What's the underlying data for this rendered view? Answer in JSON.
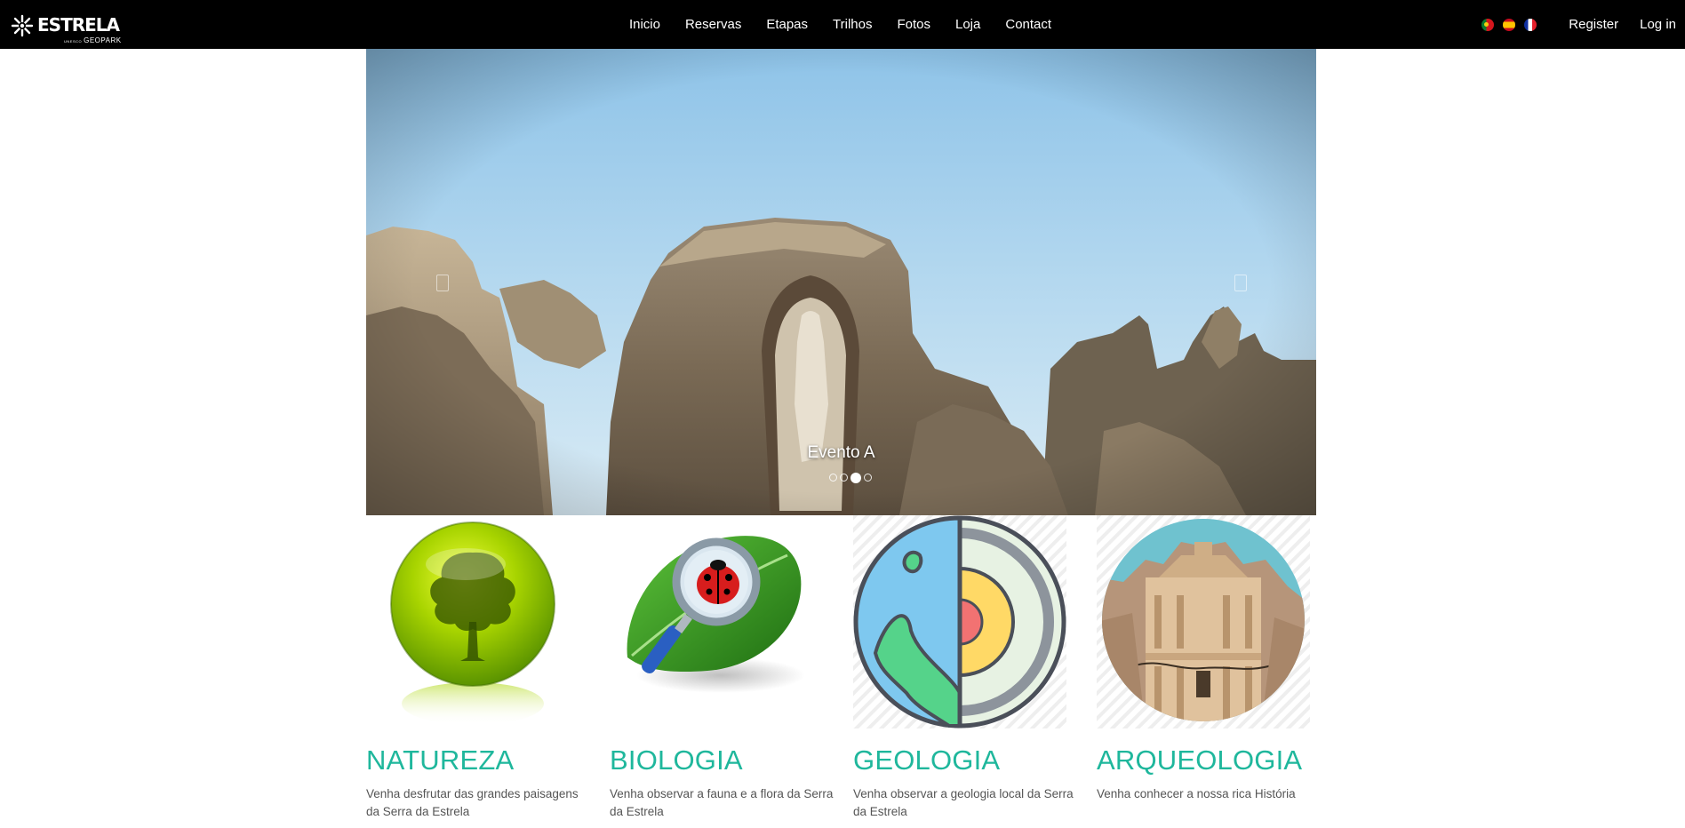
{
  "brand": {
    "name": "ESTRELA",
    "sub": "GEOPARK",
    "sub_small": "UNESCO"
  },
  "nav": {
    "items": [
      {
        "label": "Inicio"
      },
      {
        "label": "Reservas"
      },
      {
        "label": "Etapas"
      },
      {
        "label": "Trilhos"
      },
      {
        "label": "Fotos"
      },
      {
        "label": "Loja"
      },
      {
        "label": "Contact"
      }
    ],
    "languages": [
      "pt-flag-icon",
      "es-flag-icon",
      "fr-flag-icon"
    ],
    "register_label": "Register",
    "login_label": "Log in"
  },
  "carousel": {
    "caption": "Evento A",
    "slide_count": 4,
    "active_index": 2,
    "prev_icon": "chevron-left-icon",
    "next_icon": "chevron-right-icon"
  },
  "features": [
    {
      "title": "NATUREZA",
      "description": "Venha desfrutar das grandes paisagens da Serra da Estrela",
      "icon": "tree-icon"
    },
    {
      "title": "BIOLOGIA",
      "description": "Venha observar a fauna e a flora da Serra da Estrela",
      "icon": "ladybug-magnifier-icon"
    },
    {
      "title": "GEOLOGIA",
      "description": "Venha observar a geologia local da Serra da Estrela",
      "icon": "earth-layers-icon"
    },
    {
      "title": "ARQUEOLOGIA",
      "description": "Venha conhecer a nossa rica História",
      "icon": "temple-icon"
    }
  ],
  "colors": {
    "accent": "#1fb79c",
    "navbar": "#000000",
    "sky": "#a9d2ee"
  }
}
